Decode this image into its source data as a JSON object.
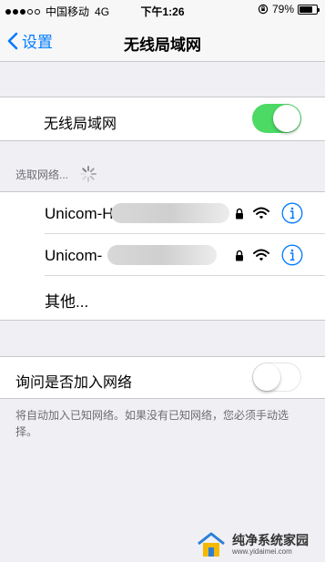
{
  "status_bar": {
    "carrier": "中国移动",
    "network": "4G",
    "time": "下午1:26",
    "battery_percent": "79%",
    "battery_level": 0.79,
    "signal_bars": 3
  },
  "nav": {
    "back_label": "设置",
    "title": "无线局域网"
  },
  "wifi_toggle": {
    "label": "无线局域网",
    "on": true
  },
  "networks_section": {
    "header": "选取网络...",
    "networks": [
      {
        "name": "Unicom-H",
        "locked": true
      },
      {
        "name": "Unicom-",
        "locked": true
      }
    ],
    "other_label": "其他..."
  },
  "ask_join": {
    "label": "询问是否加入网络",
    "on": false,
    "description": "将自动加入已知网络。如果没有已知网络，您必须手动选择。"
  },
  "watermark": {
    "text": "纯净系统家园",
    "url": "www.yidaimei.com"
  },
  "colors": {
    "accent": "#007aff",
    "toggle_on": "#4cd964",
    "background": "#efeff4"
  }
}
